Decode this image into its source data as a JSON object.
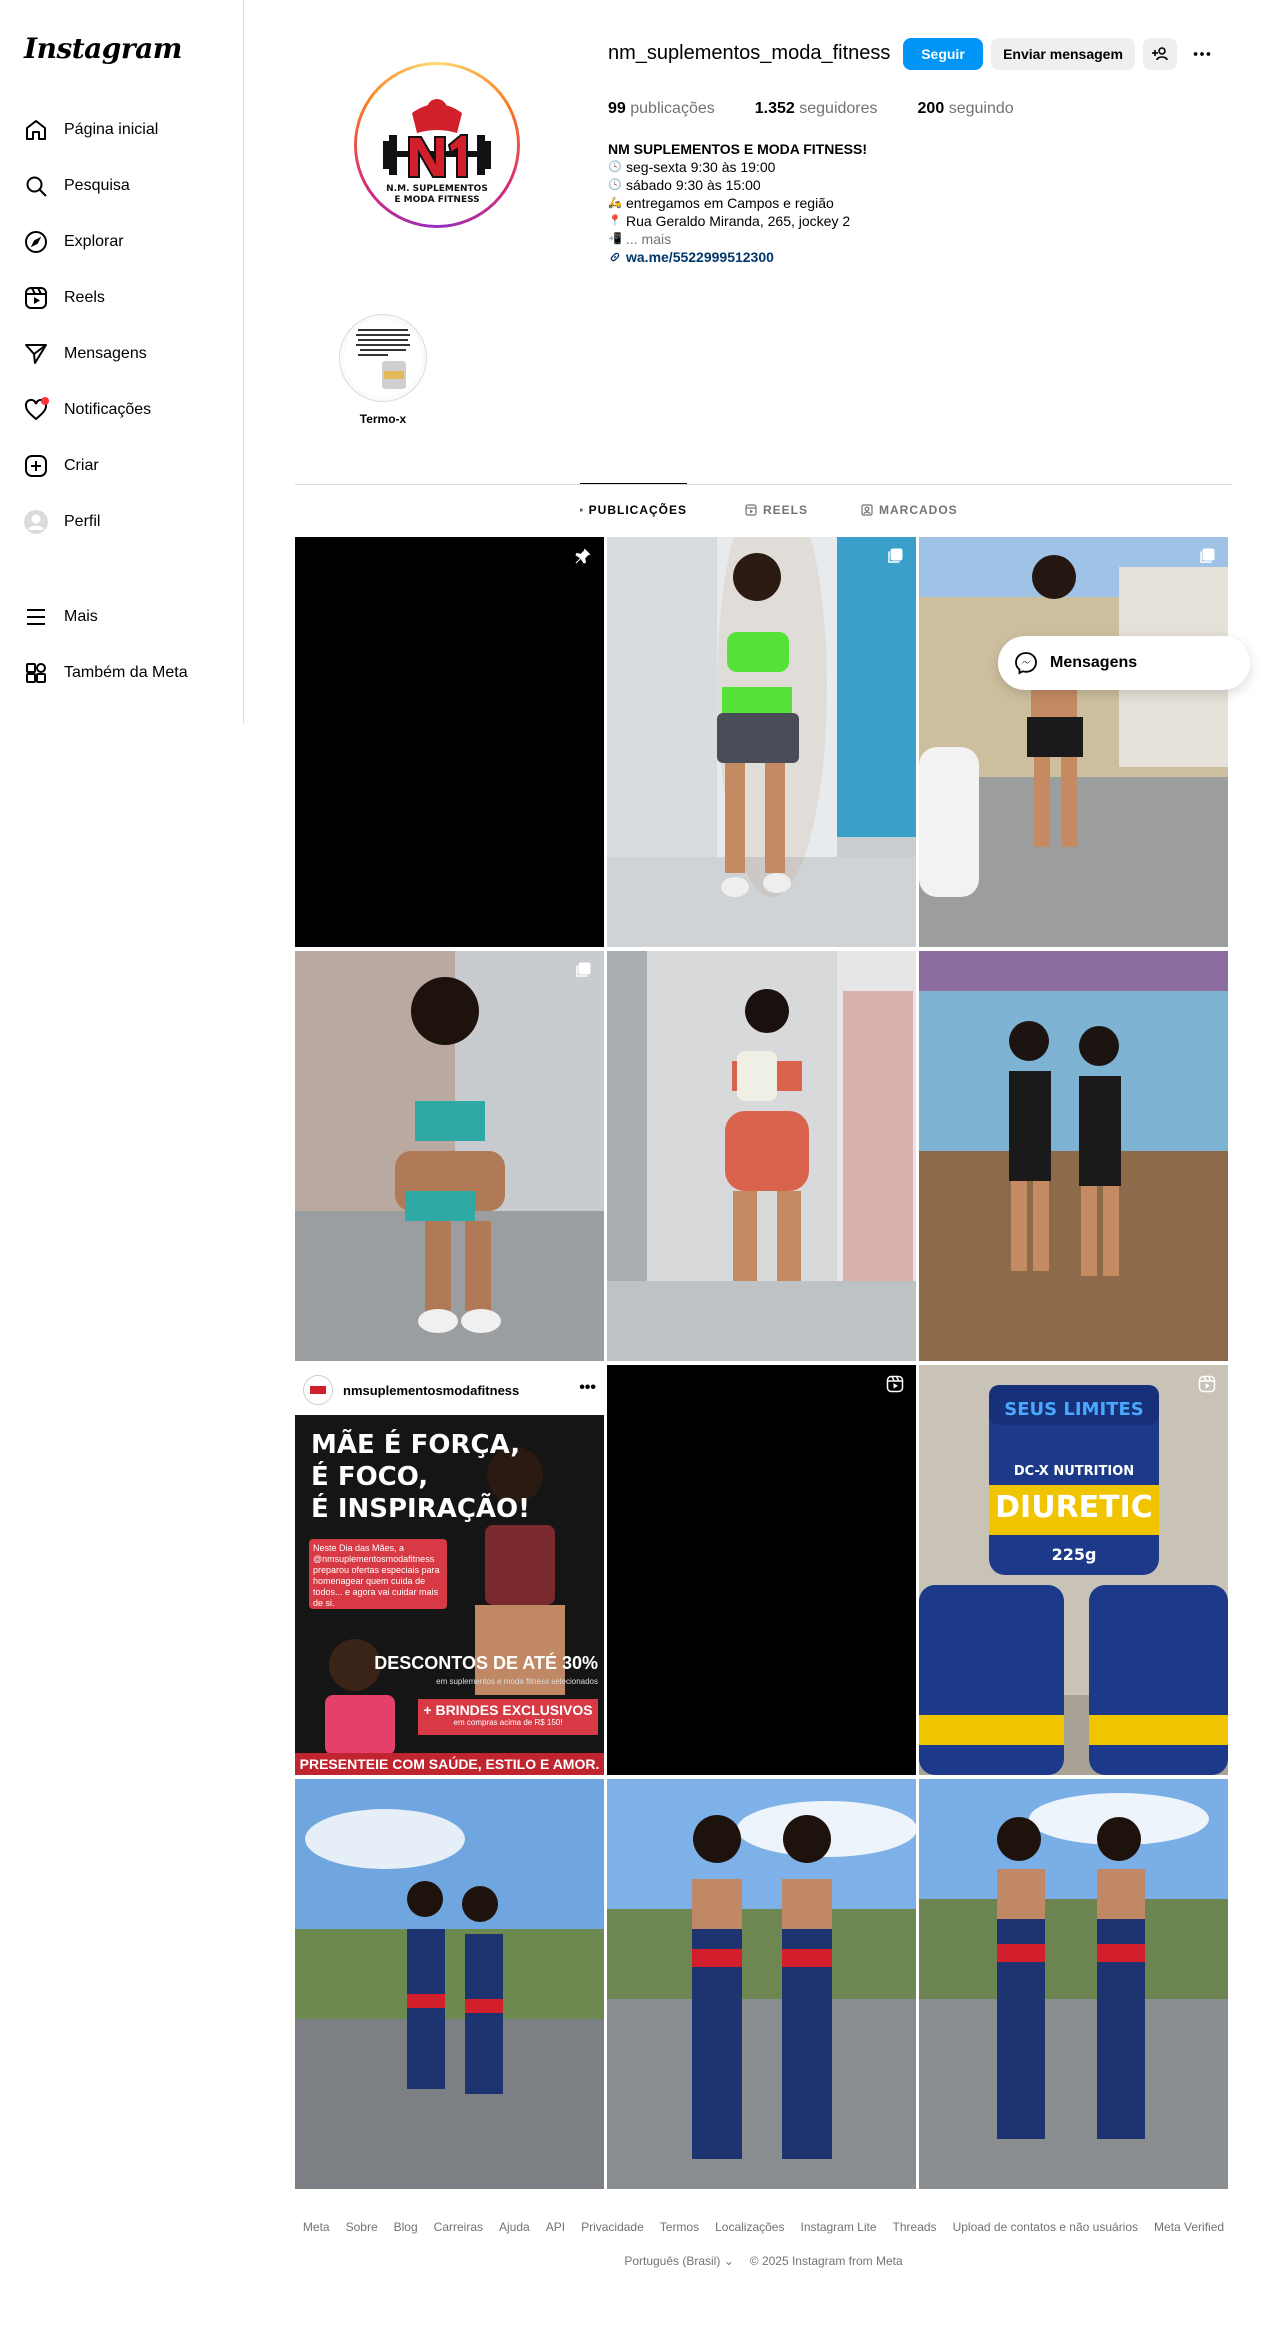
{
  "app": {
    "logo_text": "Instagram"
  },
  "sidebar": {
    "items": [
      {
        "label": "Página inicial",
        "icon": "home-icon"
      },
      {
        "label": "Pesquisa",
        "icon": "search-icon"
      },
      {
        "label": "Explorar",
        "icon": "compass-icon"
      },
      {
        "label": "Reels",
        "icon": "reels-icon"
      },
      {
        "label": "Mensagens",
        "icon": "send-icon"
      },
      {
        "label": "Notificações",
        "icon": "heart-icon"
      },
      {
        "label": "Criar",
        "icon": "plus-square-icon"
      },
      {
        "label": "Perfil",
        "icon": "avatar-icon"
      },
      {
        "label": "Mais",
        "icon": "hamburger-icon"
      },
      {
        "label": "Também da Meta",
        "icon": "meta-apps-icon"
      }
    ]
  },
  "profile": {
    "username": "nm_suplementos_moda_fitness",
    "avatar_text": [
      "N.M. SUPLEMENTOS",
      "E MODA FITNESS"
    ],
    "follow_label": "Seguir",
    "message_label": "Enviar mensagem",
    "stats": {
      "posts_count": "99",
      "posts_label": "publicações",
      "followers_count": "1.352",
      "followers_label": "seguidores",
      "following_count": "200",
      "following_label": "seguindo"
    },
    "bio": {
      "name": "NM SUPLEMENTOS E MODA FITNESS!",
      "line1": "seg-sexta 9:30 às 19:00",
      "line2": "sábado 9:30 às 15:00",
      "line3": "entregamos em Campos e região",
      "line4": "Rua Geraldo Miranda, 265, jockey 2",
      "more": "... mais",
      "link": "wa.me/5522999512300"
    }
  },
  "highlight": {
    "label": "Termo-x"
  },
  "tabs": [
    {
      "label": "PUBLICAÇÕES"
    },
    {
      "label": "REELS"
    },
    {
      "label": "MARCADOS"
    }
  ],
  "promo_post": {
    "account": "nmsuplementosmodafitness",
    "title_lines": [
      "MÃE É FORÇA,",
      "É FOCO,",
      "É INSPIRAÇÃO!"
    ],
    "redbox_text": "Neste Dia das Mães, a @nmsuplementosmodafitness preparou ofertas especiais para homenagear quem cuida de todos... e agora vai cuidar mais de si.",
    "discount": "DESCONTOS DE ATÉ 30%",
    "discount_sub": "em suplementos e moda fitness selecionados",
    "brindes": "+ BRINDES EXCLUSIVOS",
    "brindes_sub": "em compras acima de R$ 150!",
    "footer": "PRESENTEIE COM SAÚDE, ESTILO E AMOR."
  },
  "product_post": {
    "brand": "DC-X NUTRITION",
    "product": "DIURETIC",
    "tagline": "SEUS LIMITES",
    "weight": "225g"
  },
  "floating_messages": {
    "label": "Mensagens"
  },
  "footer": {
    "links": [
      "Meta",
      "Sobre",
      "Blog",
      "Carreiras",
      "Ajuda",
      "API",
      "Privacidade",
      "Termos",
      "Localizações",
      "Instagram Lite",
      "Threads",
      "Upload de contatos e não usuários",
      "Meta Verified"
    ],
    "language": "Português (Brasil)",
    "copyright": "© 2025 Instagram from Meta"
  }
}
